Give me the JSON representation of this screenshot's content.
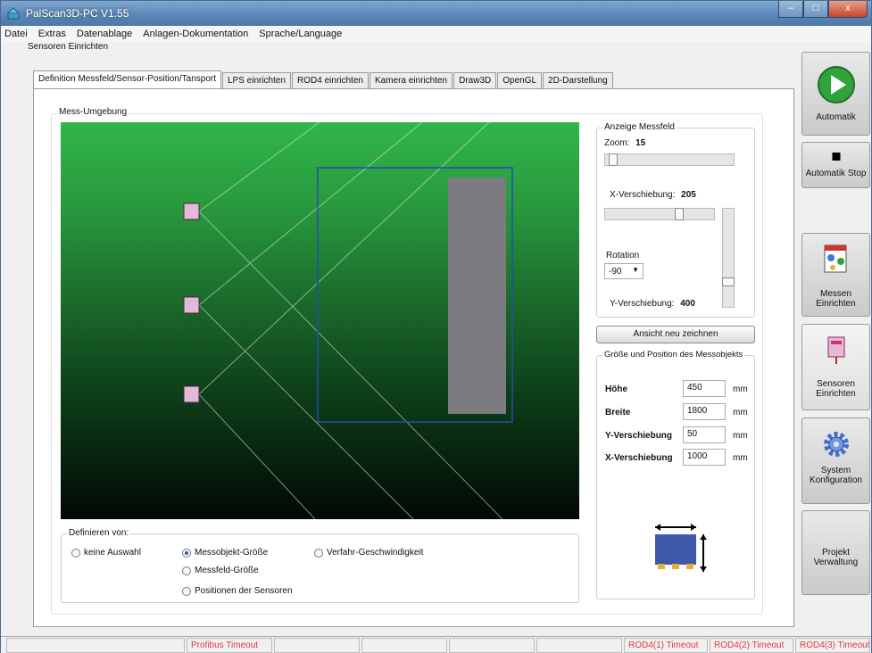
{
  "window": {
    "title": "PalScan3D-PC V1.55",
    "minimize": "–",
    "maximize": "□",
    "close": "x"
  },
  "menu": [
    "Datei",
    "Extras",
    "Datenablage",
    "Anlagen-Dokumentation",
    "Sprache/Language"
  ],
  "subtitle": "Sensoren Einrichten",
  "tabs": [
    "Definition Messfeld/Sensor-Position/Tansport",
    "LPS einrichten",
    "ROD4 einrichten",
    "Kamera einrichten",
    "Draw3D",
    "OpenGL",
    "2D-Darstellung"
  ],
  "mess_umgebung": {
    "label": "Mess-Umgebung"
  },
  "anzeige": {
    "label": "Anzeige Messfeld",
    "zoom_label": "Zoom:",
    "zoom_value": "15",
    "x_label": "X-Verschiebung:",
    "x_value": "205",
    "rotation_label": "Rotation",
    "rotation_value": "-90",
    "y_label": "Y-Verschiebung:",
    "y_value": "400",
    "redraw_button": "Ansicht neu zeichnen"
  },
  "messobjekt": {
    "label": "Größe und Position des Messobjekts",
    "rows": [
      {
        "label": "Höhe",
        "value": "450",
        "unit": "mm"
      },
      {
        "label": "Breite",
        "value": "1800",
        "unit": "mm"
      },
      {
        "label": "Y-Verschiebung",
        "value": "50",
        "unit": "mm"
      },
      {
        "label": "X-Verschiebung",
        "value": "1000",
        "unit": "mm"
      }
    ]
  },
  "definieren": {
    "label": "Definieren von:",
    "options": [
      {
        "label": "keine Auswahl",
        "selected": false
      },
      {
        "label": "Messobjekt-Größe",
        "selected": true
      },
      {
        "label": "Messfeld-Größe",
        "selected": false
      },
      {
        "label": "Positionen der Sensoren",
        "selected": false
      },
      {
        "label": "Verfahr-Geschwindigkeit",
        "selected": false
      }
    ]
  },
  "sidebar": {
    "automatik": "Automatik",
    "automatik_stop": "Automatik Stop",
    "messen_line1": "Messen",
    "messen_line2": "Einrichten",
    "sensoren_line1": "Sensoren",
    "sensoren_line2": "Einrichten",
    "system_line1": "System",
    "system_line2": "Konfiguration",
    "projekt_line1": "Projekt",
    "projekt_line2": "Verwaltung"
  },
  "status": {
    "profibus": "Profibus Timeout",
    "rod4_1": "ROD4(1) Timeout",
    "rod4_2": "ROD4(2) Timeout",
    "rod4_3": "ROD4(3) Timeout"
  },
  "colors": {
    "status_error": "#e03a3a",
    "viewport_top": "#31b54a",
    "object_fill": "#7c7c80",
    "sensor_fill": "#e6b8d8",
    "frame_blue": "#1f4fb5",
    "icon_box": "#3f58a8",
    "icon_feet": "#e3b13a",
    "play_green": "#2ea43a"
  },
  "icons": [
    "app-icon",
    "play-icon",
    "stop-icon",
    "measure-setup-icon",
    "sensor-icon",
    "gear-icon",
    "object-size-icon"
  ]
}
